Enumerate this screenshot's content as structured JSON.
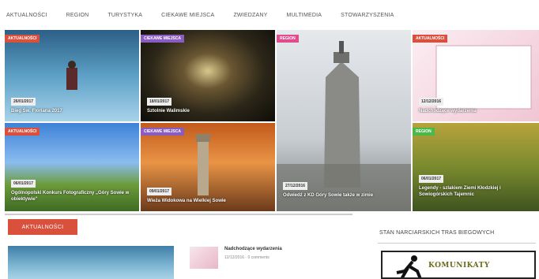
{
  "nav": [
    "AKTUALNOŚCI",
    "REGION",
    "TURYSTYKA",
    "CIEKAWE MIEJSCA",
    "ZWIEDZANY",
    "MULTIMEDIA",
    "STOWARZYSZENIA"
  ],
  "tiles": [
    {
      "badge": "AKTUALNOŚCI",
      "badge_color": "red",
      "date": "26/01/2017",
      "caption": "Bieg Św. Floriana 2017"
    },
    {
      "badge": "CIEKAWE MIEJSCA",
      "badge_color": "purple",
      "date": "18/01/2017",
      "caption": "Sztolnie Walimskie"
    },
    {
      "badge": "REGION",
      "badge_color": "pink",
      "date": "27/12/2016",
      "caption": "Odwiedź z KD Góry Sowie także w zimie"
    },
    {
      "badge": "AKTUALNOŚCI",
      "badge_color": "red",
      "date": "12/12/2016",
      "caption": "Nadchodzące wydarzenia"
    },
    {
      "badge": "AKTUALNOŚCI",
      "badge_color": "red",
      "date": "06/01/2017",
      "caption": "Ogólnopolski Konkurs Fotograficzny „Góry Sowie w obiektywie”"
    },
    {
      "badge": "CIEKAWE MIEJSCA",
      "badge_color": "purple",
      "date": "09/01/2017",
      "caption": "Wieża Widokowa na Wielkiej Sowie"
    },
    {
      "badge": "REGION",
      "badge_color": "green",
      "date": "06/01/2017",
      "caption": "Legendy - szlakiem Ziemi Kłodzkiej i Sowiogórskich Tajemnic"
    }
  ],
  "section": {
    "label": "AKTUALNOŚCI"
  },
  "article": {
    "title": "Nadchodzące wydarzenia",
    "meta": "12/12/2016  ·  0 comments"
  },
  "sidebar": {
    "title": "STAN NARCIARSKICH TRAS BIEGOWYCH",
    "banner": "KOMUNIKATY"
  },
  "colors": {
    "red": "#d9503c",
    "purple": "#8b5cbf",
    "pink": "#e04d8e",
    "green": "#4cb848"
  }
}
